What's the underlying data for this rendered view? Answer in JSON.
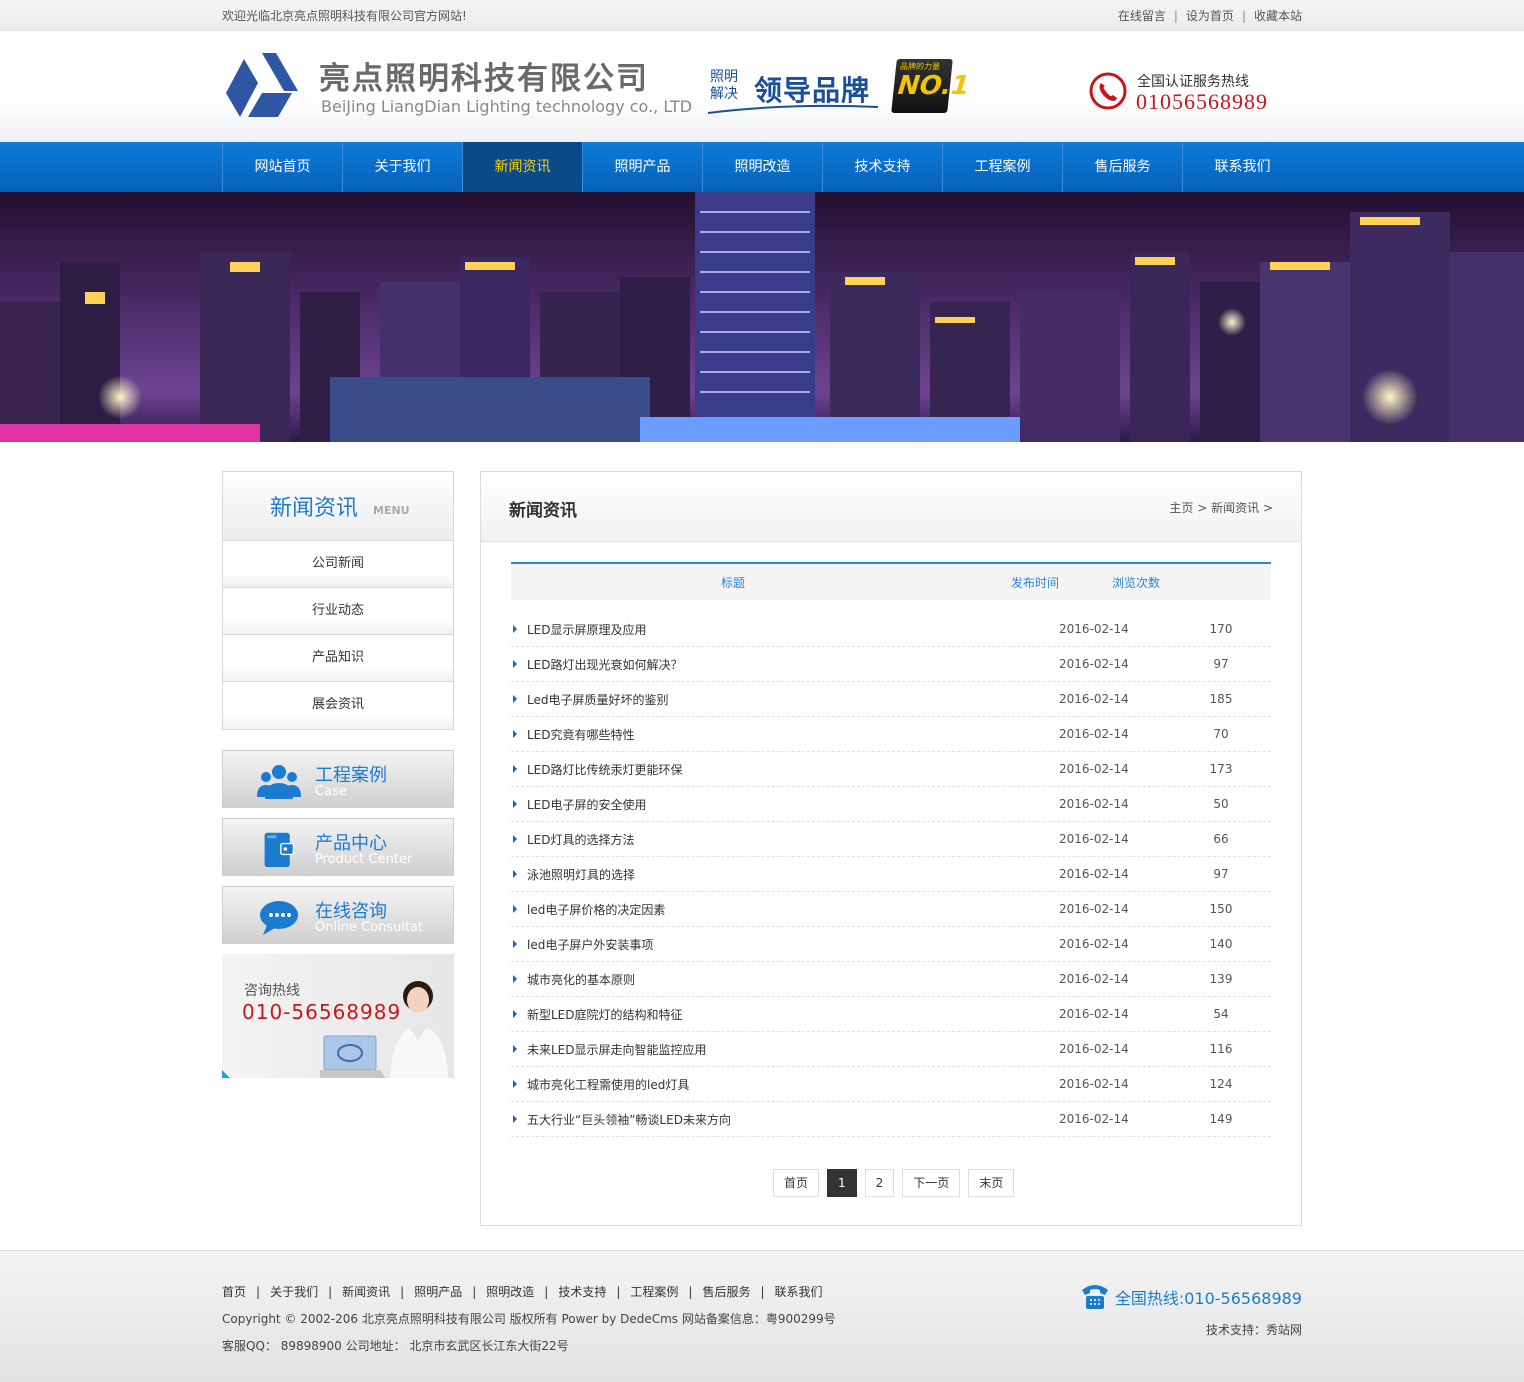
{
  "topbar": {
    "welcome": "欢迎光临北京亮点照明科技有限公司官方网站!",
    "links": [
      "在线留言",
      "设为首页",
      "收藏本站"
    ],
    "sep": "|"
  },
  "header": {
    "company_name": "亮点照明科技有限公司",
    "company_en": "BeiJing LiangDian Lighting technology co., LTD",
    "slogan_small": "照明解决",
    "slogan_big": "领导品牌",
    "badge_top": "品牌的力量",
    "badge": "NO.1",
    "hotline_label": "全国认证服务热线",
    "hotline_number": "01056568989"
  },
  "nav": {
    "items": [
      "网站首页",
      "关于我们",
      "新闻资讯",
      "照明产品",
      "照明改造",
      "技术支持",
      "工程案例",
      "售后服务",
      "联系我们"
    ],
    "active": "新闻资讯"
  },
  "sidebar": {
    "title": "新闻资讯",
    "title_en": "MENU",
    "menu": [
      "公司新闻",
      "行业动态",
      "产品知识",
      "展会资讯"
    ],
    "buttons": [
      {
        "cn": "工程案例",
        "en": "Case",
        "icon": "people-icon"
      },
      {
        "cn": "产品中心",
        "en": "Product Center",
        "icon": "wallet-icon"
      },
      {
        "cn": "在线咨询",
        "en": "Online Consultat",
        "icon": "chat-bubble-icon"
      }
    ],
    "ad": {
      "label": "咨询热线",
      "number": "010-56568989"
    }
  },
  "main": {
    "title": "新闻资讯",
    "breadcrumb": [
      "主页",
      "新闻资讯"
    ],
    "breadcrumb_sep": ">",
    "columns": [
      "标题",
      "发布时间",
      "浏览次数"
    ],
    "rows": [
      {
        "title": "LED显示屏原理及应用",
        "date": "2016-02-14",
        "views": "170"
      },
      {
        "title": "LED路灯出现光衰如何解决？",
        "date": "2016-02-14",
        "views": "97"
      },
      {
        "title": "Led电子屏质量好坏的鉴别",
        "date": "2016-02-14",
        "views": "185"
      },
      {
        "title": "LED究竟有哪些特性",
        "date": "2016-02-14",
        "views": "70"
      },
      {
        "title": "LED路灯比传统汞灯更能环保",
        "date": "2016-02-14",
        "views": "173"
      },
      {
        "title": "LED电子屏的安全使用",
        "date": "2016-02-14",
        "views": "50"
      },
      {
        "title": "LED灯具的选择方法",
        "date": "2016-02-14",
        "views": "66"
      },
      {
        "title": "泳池照明灯具的选择",
        "date": "2016-02-14",
        "views": "97"
      },
      {
        "title": "led电子屏价格的决定因素",
        "date": "2016-02-14",
        "views": "150"
      },
      {
        "title": "led电子屏户外安装事项",
        "date": "2016-02-14",
        "views": "140"
      },
      {
        "title": "城市亮化的基本原则",
        "date": "2016-02-14",
        "views": "139"
      },
      {
        "title": "新型LED庭院灯的结构和特征",
        "date": "2016-02-14",
        "views": "54"
      },
      {
        "title": "未来LED显示屏走向智能监控应用",
        "date": "2016-02-14",
        "views": "116"
      },
      {
        "title": "城市亮化工程需使用的led灯具",
        "date": "2016-02-14",
        "views": "124"
      },
      {
        "title": "五大行业“巨头领袖”畅谈LED未来方向",
        "date": "2016-02-14",
        "views": "149"
      }
    ],
    "pager": {
      "first": "首页",
      "pages": [
        "1",
        "2"
      ],
      "current": "1",
      "next": "下一页",
      "last": "末页"
    }
  },
  "footer": {
    "links": [
      "首页",
      "关于我们",
      "新闻资讯",
      "照明产品",
      "照明改造",
      "技术支持",
      "工程案例",
      "售后服务",
      "联系我们"
    ],
    "sep": "|",
    "copyright": "Copyright © 2002-206 北京亮点照明科技有限公司 版权所有 Power by DedeCms 网站备案信息：粤900299号",
    "address": "客服QQ： 89898900 公司地址： 北京市玄武区长江东大街22号",
    "hotline": "全国热线:010-56568989",
    "tech_support": "技术支持：秀站网"
  },
  "colors": {
    "brand_blue": "#0e7ad9",
    "nav_active": "#0a4a88",
    "accent_yellow": "#f6d300",
    "hotline_red": "#c8161d"
  }
}
